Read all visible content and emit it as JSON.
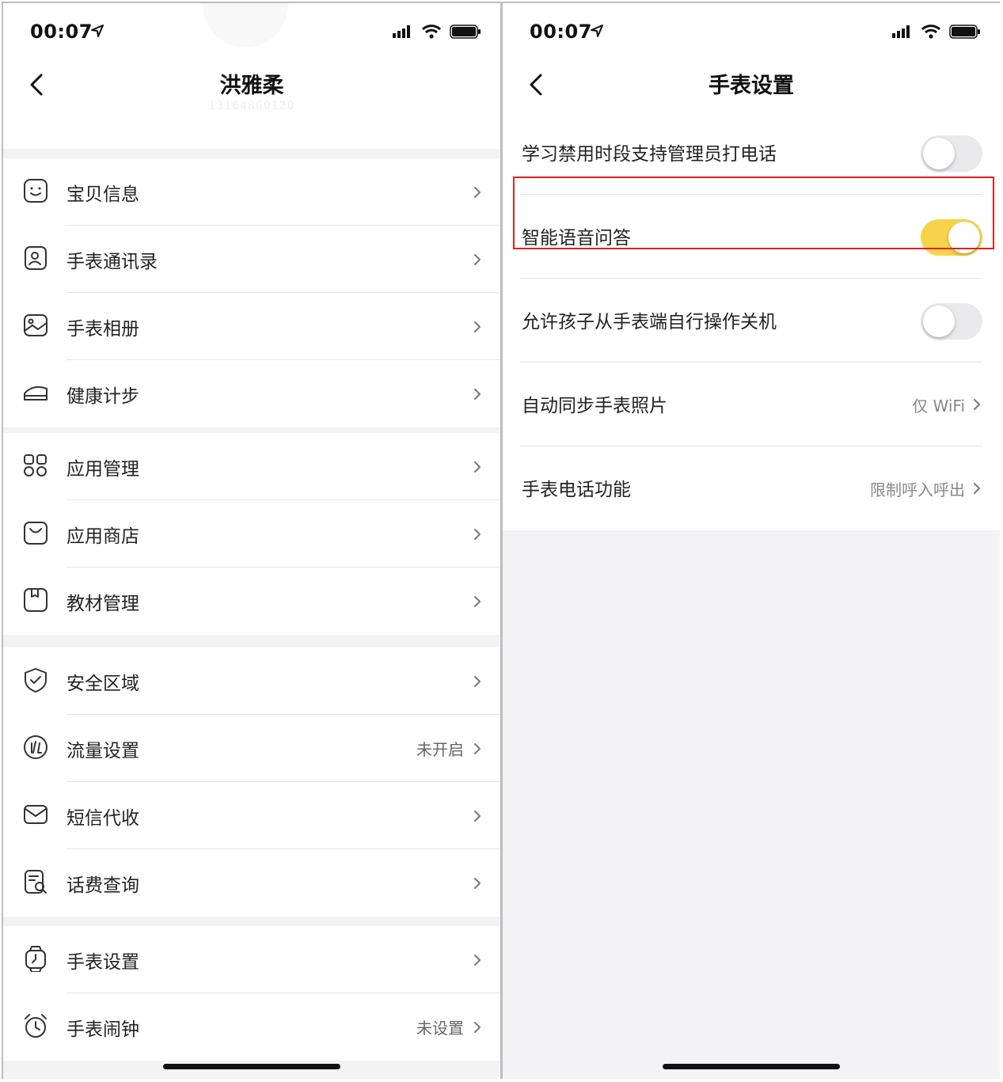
{
  "colors": {
    "accent": "#f7d34a",
    "highlight": "#e02020",
    "background": "#f3f3f5"
  },
  "left": {
    "status": {
      "time": "00:07"
    },
    "header": {
      "title": "洪雅柔",
      "subtitle": "13164860120"
    },
    "groups": [
      [
        {
          "icon": "face-icon",
          "label": "宝贝信息",
          "value": ""
        },
        {
          "icon": "contacts-icon",
          "label": "手表通讯录",
          "value": ""
        },
        {
          "icon": "album-icon",
          "label": "手表相册",
          "value": ""
        },
        {
          "icon": "health-steps-icon",
          "label": "健康计步",
          "value": ""
        }
      ],
      [
        {
          "icon": "apps-grid-icon",
          "label": "应用管理",
          "value": ""
        },
        {
          "icon": "shopping-bag-icon",
          "label": "应用商店",
          "value": ""
        },
        {
          "icon": "book-icon",
          "label": "教材管理",
          "value": ""
        }
      ],
      [
        {
          "icon": "shield-icon",
          "label": "安全区域",
          "value": ""
        },
        {
          "icon": "data-usage-icon",
          "label": "流量设置",
          "value": "未开启"
        },
        {
          "icon": "mail-icon",
          "label": "短信代收",
          "value": ""
        },
        {
          "icon": "bill-search-icon",
          "label": "话费查询",
          "value": ""
        }
      ],
      [
        {
          "icon": "watch-icon",
          "label": "手表设置",
          "value": ""
        },
        {
          "icon": "alarm-clock-icon",
          "label": "手表闹钟",
          "value": "未设置"
        }
      ]
    ]
  },
  "right": {
    "status": {
      "time": "00:07"
    },
    "header": {
      "title": "手表设置"
    },
    "settings": [
      {
        "label": "学习禁用时段支持管理员打电话",
        "type": "toggle",
        "on": false
      },
      {
        "label": "智能语音问答",
        "type": "toggle",
        "on": true
      },
      {
        "label": "允许孩子从手表端自行操作关机",
        "type": "toggle",
        "on": false,
        "highlighted": true
      },
      {
        "label": "自动同步手表照片",
        "type": "link",
        "value": "仅 WiFi"
      },
      {
        "label": "手表电话功能",
        "type": "link",
        "value": "限制呼入呼出"
      }
    ]
  }
}
